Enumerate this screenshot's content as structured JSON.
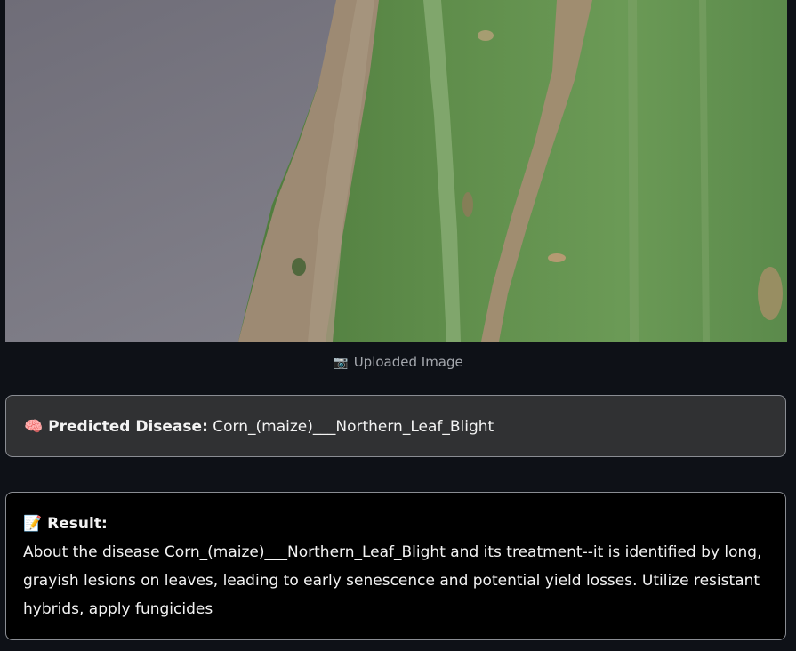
{
  "uploaded_image": {
    "caption_icon": "camera-icon",
    "caption": "Uploaded Image"
  },
  "prediction": {
    "icon": "brain-icon",
    "label": "Predicted Disease:",
    "value": "Corn_(maize)___Northern_Leaf_Blight"
  },
  "result": {
    "icon": "memo-icon",
    "label": "Result:",
    "text": "About the disease Corn_(maize)___Northern_Leaf_Blight and its treatment--it is identified by long, grayish lesions on leaves, leading to early senescence and potential yield losses. Utilize resistant hybrids, apply fungicides"
  }
}
